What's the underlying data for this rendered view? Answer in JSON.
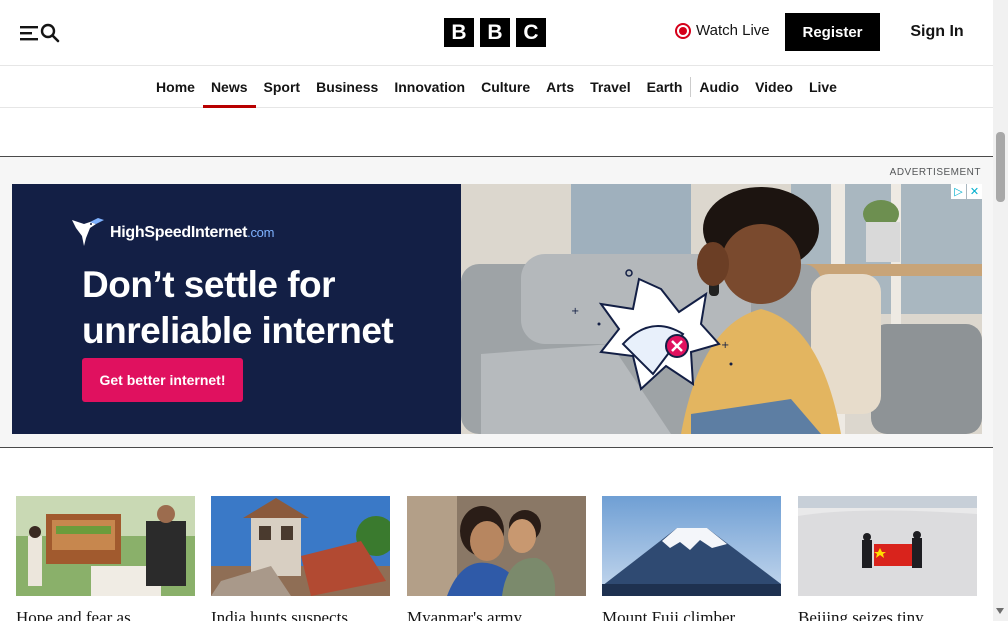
{
  "header": {
    "logo_letters": [
      "B",
      "B",
      "C"
    ],
    "watch_live_label": "Watch Live",
    "register_label": "Register",
    "signin_label": "Sign In",
    "menu_icon": "hamburger-icon",
    "search_icon": "search-icon"
  },
  "nav": {
    "items": [
      "Home",
      "News",
      "Sport",
      "Business",
      "Innovation",
      "Culture",
      "Arts",
      "Travel",
      "Earth",
      "Audio",
      "Video",
      "Live"
    ],
    "active": "News"
  },
  "ad": {
    "label": "ADVERTISEMENT",
    "brand": "HighSpeedInternet",
    "brand_suffix": ".com",
    "headline": "Don’t settle for unreliable internet",
    "cta": "Get better internet!"
  },
  "stories": [
    {
      "title": "Hope and fear as"
    },
    {
      "title": "India hunts suspects"
    },
    {
      "title": "Myanmar's army"
    },
    {
      "title": "Mount Fuji climber"
    },
    {
      "title": "Beijing seizes tiny"
    }
  ],
  "colors": {
    "brand_red": "#b80000",
    "live_red": "#d5001a",
    "ad_navy": "#131f45",
    "ad_cta": "#e0115f"
  }
}
